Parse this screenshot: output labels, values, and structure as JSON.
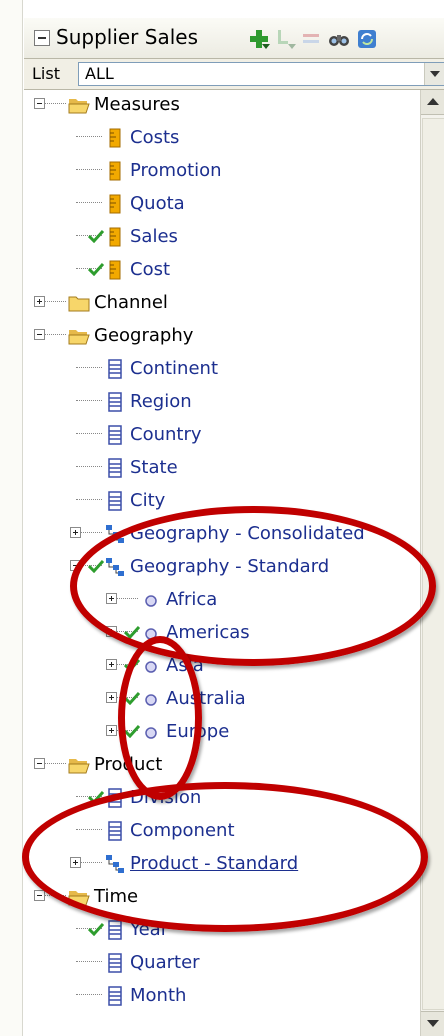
{
  "header": {
    "title": "Supplier Sales",
    "tools": [
      {
        "name": "add-icon"
      },
      {
        "name": "add-child-icon"
      },
      {
        "name": "remove-icon"
      },
      {
        "name": "find-icon"
      },
      {
        "name": "refresh-icon"
      }
    ]
  },
  "list": {
    "label": "List",
    "value": "ALL"
  },
  "tree": [
    {
      "level": 0,
      "expander": "minus",
      "check": false,
      "icon": "folder-open",
      "label": "Measures",
      "color": "black"
    },
    {
      "level": 1,
      "expander": "none",
      "check": false,
      "icon": "measure",
      "label": "Costs",
      "color": "blue"
    },
    {
      "level": 1,
      "expander": "none",
      "check": false,
      "icon": "measure",
      "label": "Promotion",
      "color": "blue"
    },
    {
      "level": 1,
      "expander": "none",
      "check": false,
      "icon": "measure",
      "label": "Quota",
      "color": "blue"
    },
    {
      "level": 1,
      "expander": "none",
      "check": true,
      "icon": "measure",
      "label": "Sales",
      "color": "blue"
    },
    {
      "level": 1,
      "expander": "none",
      "check": true,
      "icon": "measure",
      "label": "Cost",
      "color": "blue"
    },
    {
      "level": 0,
      "expander": "plus",
      "check": false,
      "icon": "folder-closed",
      "label": "Channel",
      "color": "black"
    },
    {
      "level": 0,
      "expander": "minus",
      "check": false,
      "icon": "folder-open",
      "label": "Geography",
      "color": "black"
    },
    {
      "level": 1,
      "expander": "none",
      "check": false,
      "icon": "level",
      "label": "Continent",
      "color": "blue"
    },
    {
      "level": 1,
      "expander": "none",
      "check": false,
      "icon": "level",
      "label": "Region",
      "color": "blue"
    },
    {
      "level": 1,
      "expander": "none",
      "check": false,
      "icon": "level",
      "label": "Country",
      "color": "blue"
    },
    {
      "level": 1,
      "expander": "none",
      "check": false,
      "icon": "level",
      "label": "State",
      "color": "blue"
    },
    {
      "level": 1,
      "expander": "none",
      "check": false,
      "icon": "level",
      "label": "City",
      "color": "blue"
    },
    {
      "level": 1,
      "expander": "plus",
      "check": false,
      "icon": "hierarchy",
      "label": "Geography - Consolidated",
      "color": "blue"
    },
    {
      "level": 1,
      "expander": "minus",
      "check": true,
      "icon": "hierarchy",
      "label": "Geography - Standard",
      "color": "blue"
    },
    {
      "level": 2,
      "expander": "plus",
      "check": false,
      "icon": "member",
      "label": "Africa",
      "color": "blue"
    },
    {
      "level": 2,
      "expander": "plus",
      "check": true,
      "icon": "member",
      "label": "Americas",
      "color": "blue"
    },
    {
      "level": 2,
      "expander": "plus",
      "check": true,
      "icon": "member",
      "label": "Asia",
      "color": "blue"
    },
    {
      "level": 2,
      "expander": "plus",
      "check": true,
      "icon": "member",
      "label": "Australia",
      "color": "blue"
    },
    {
      "level": 2,
      "expander": "plus",
      "check": true,
      "icon": "member",
      "label": "Europe",
      "color": "blue"
    },
    {
      "level": 0,
      "expander": "minus",
      "check": false,
      "icon": "folder-open",
      "label": "Product",
      "color": "black"
    },
    {
      "level": 1,
      "expander": "none",
      "check": true,
      "icon": "level",
      "label": "Division",
      "color": "blue"
    },
    {
      "level": 1,
      "expander": "none",
      "check": false,
      "icon": "level",
      "label": "Component",
      "color": "blue"
    },
    {
      "level": 1,
      "expander": "plus",
      "check": false,
      "icon": "hierarchy",
      "label": "Product - Standard",
      "color": "blue",
      "underline": true
    },
    {
      "level": 0,
      "expander": "minus",
      "check": false,
      "icon": "folder-open",
      "label": "Time",
      "color": "black"
    },
    {
      "level": 1,
      "expander": "none",
      "check": true,
      "icon": "level",
      "label": "Year",
      "color": "blue"
    },
    {
      "level": 1,
      "expander": "none",
      "check": false,
      "icon": "level",
      "label": "Quarter",
      "color": "blue"
    },
    {
      "level": 1,
      "expander": "none",
      "check": false,
      "icon": "level",
      "label": "Month",
      "color": "blue"
    }
  ],
  "colors": {
    "annotation": "#c00000",
    "check": "#2e9d2e",
    "measure": "#f2a900",
    "folder": "#f7d66a",
    "level": "#3b4ea8"
  }
}
